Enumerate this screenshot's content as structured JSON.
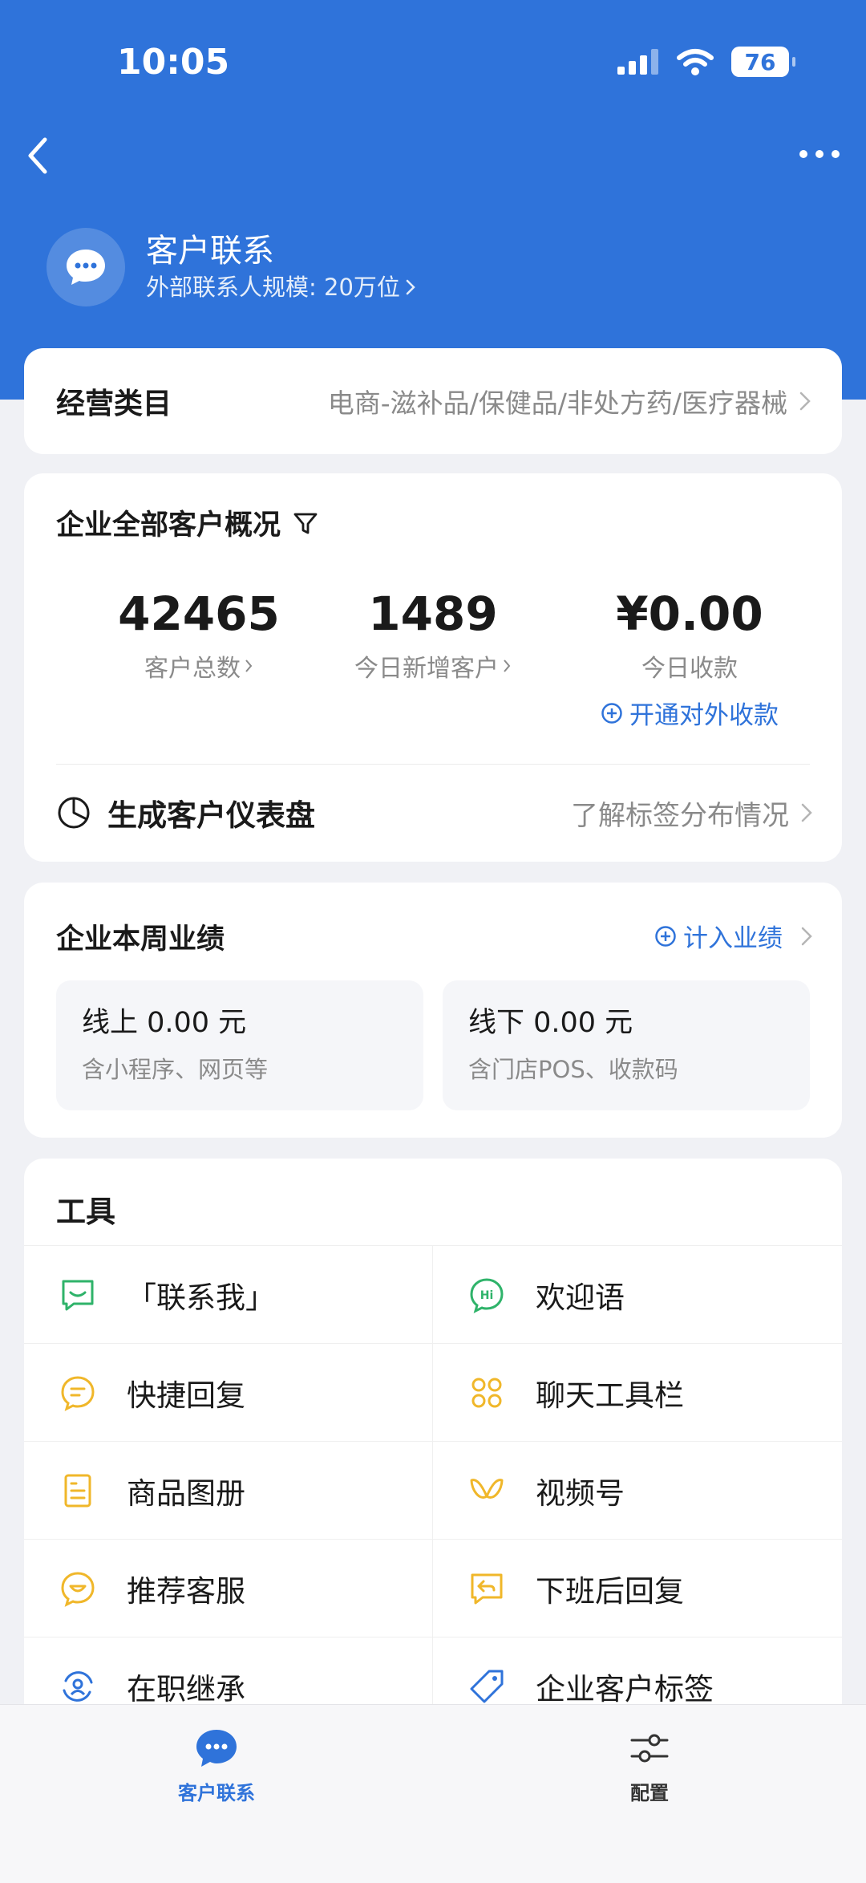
{
  "status_bar": {
    "time": "10:05",
    "battery": "76"
  },
  "header": {
    "title": "客户联系",
    "subtitle": "外部联系人规模: 20万位"
  },
  "category": {
    "label": "经营类目",
    "value": "电商-滋补品/保健品/非处方药/医疗器械"
  },
  "overview": {
    "title": "企业全部客户概况",
    "stats": [
      {
        "value": "42465",
        "label": "客户总数"
      },
      {
        "value": "1489",
        "label": "今日新增客户"
      },
      {
        "value": "¥0.00",
        "label": "今日收款"
      }
    ],
    "payment_link": "开通对外收款",
    "dashboard_label": "生成客户仪表盘",
    "dashboard_hint": "了解标签分布情况"
  },
  "performance": {
    "title": "企业本周业绩",
    "link": "计入业绩",
    "online": {
      "title": "线上 0.00 元",
      "sub": "含小程序、网页等"
    },
    "offline": {
      "title": "线下 0.00 元",
      "sub": "含门店POS、收款码"
    }
  },
  "tools": {
    "title": "工具",
    "items": [
      {
        "label": "「联系我」",
        "icon": "contact-me-icon",
        "color": "#2fb36a"
      },
      {
        "label": "欢迎语",
        "icon": "hi-greeting-icon",
        "color": "#2fb36a"
      },
      {
        "label": "快捷回复",
        "icon": "quick-reply-icon",
        "color": "#f0b72a"
      },
      {
        "label": "聊天工具栏",
        "icon": "chat-toolbar-icon",
        "color": "#f0b72a"
      },
      {
        "label": "商品图册",
        "icon": "product-album-icon",
        "color": "#f0b72a"
      },
      {
        "label": "视频号",
        "icon": "channels-icon",
        "color": "#f0b72a"
      },
      {
        "label": "推荐客服",
        "icon": "recommend-service-icon",
        "color": "#f0b72a"
      },
      {
        "label": "下班后回复",
        "icon": "after-hours-reply-icon",
        "color": "#f0b72a"
      },
      {
        "label": "在职继承",
        "icon": "inheritance-icon",
        "color": "#2f73da"
      },
      {
        "label": "企业客户标签",
        "icon": "customer-tag-icon",
        "color": "#2f73da"
      }
    ]
  },
  "tabbar": {
    "tabs": [
      {
        "label": "客户联系",
        "icon": "chat-bubble-icon",
        "active": true
      },
      {
        "label": "配置",
        "icon": "sliders-icon",
        "active": false
      }
    ]
  },
  "colors": {
    "brand": "#2f73da",
    "background": "#f0f1f5"
  }
}
